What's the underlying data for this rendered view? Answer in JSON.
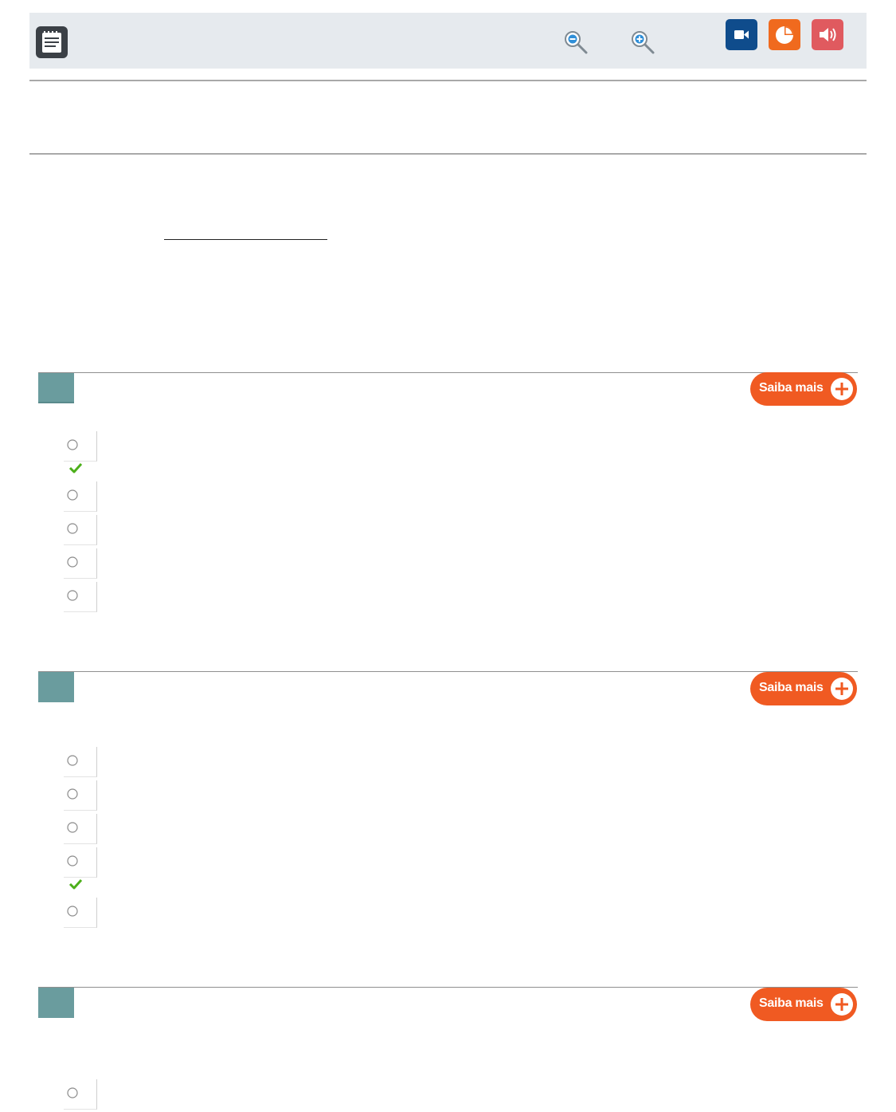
{
  "toolbar": {
    "icons": {
      "notepad": "notepad-icon",
      "zoom_out": "zoom-out-icon",
      "zoom_in": "zoom-in-icon",
      "video": "video-camera-icon",
      "chart": "pie-chart-icon",
      "audio": "speaker-icon"
    },
    "colors": {
      "background": "#e6eaee",
      "video": "#0f4c8c",
      "chart": "#f06a1e",
      "audio": "#e05a5f"
    }
  },
  "questions": [
    {
      "saiba_mais_label": "Saiba mais",
      "option_count": 5,
      "correct_option_index": 0
    },
    {
      "saiba_mais_label": "Saiba mais",
      "option_count": 5,
      "correct_option_index": 3
    },
    {
      "saiba_mais_label": "Saiba mais",
      "option_count": 1,
      "correct_option_index": null
    }
  ],
  "colors": {
    "question_number_bg": "#6a9c9e",
    "saiba_mais_bg": "#f05a22",
    "correct_check": "#4caf1a"
  }
}
